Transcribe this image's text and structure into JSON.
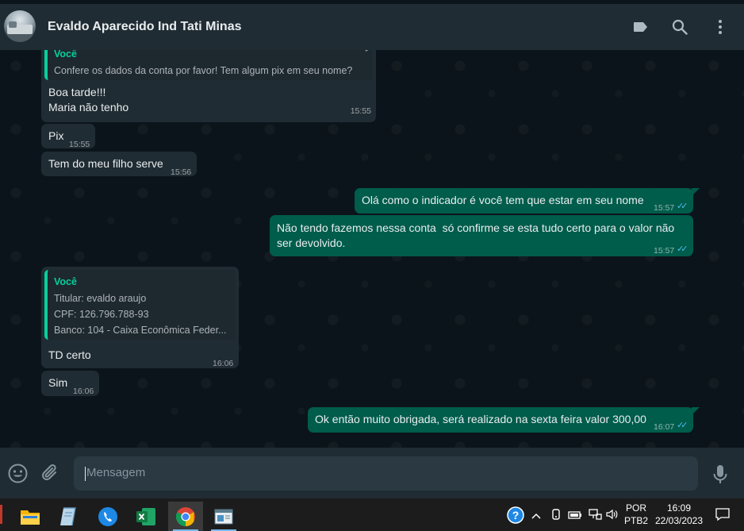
{
  "header": {
    "contact_name": "Evaldo Aparecido Ind Tati Minas",
    "icons": [
      "label-icon",
      "search-icon",
      "menu-icon"
    ]
  },
  "messages": [
    {
      "direction": "incoming",
      "quote": {
        "name": "Você",
        "lines": [
          "Confere os dados da conta por favor! Tem algum pix em seu nome?"
        ]
      },
      "lines": [
        "Boa tarde!!!",
        "Maria não tenho"
      ],
      "time": "15:55"
    },
    {
      "direction": "incoming",
      "text": "Pix",
      "time": "15:55"
    },
    {
      "direction": "incoming",
      "text": "Tem do meu filho serve",
      "time": "15:56"
    },
    {
      "direction": "outgoing",
      "text": "Olá como o indicador é você tem que estar em seu nome",
      "time": "15:57",
      "status": "read"
    },
    {
      "direction": "outgoing",
      "lines": [
        "Não tendo fazemos nessa conta  só confirme se esta tudo certo para o valor não",
        "ser devolvido."
      ],
      "time": "15:57",
      "status": "read"
    },
    {
      "direction": "incoming",
      "quote": {
        "name": "Você",
        "lines": [
          "Titular: evaldo araujo",
          "CPF: 126.796.788-93",
          "Banco: 104 - Caixa Econômica Feder..."
        ]
      },
      "text": "TD certo",
      "time": "16:06"
    },
    {
      "direction": "incoming",
      "text": "Sim",
      "time": "16:06"
    },
    {
      "direction": "outgoing",
      "text": "Ok então muito obrigada, será realizado na sexta feira valor 300,00",
      "time": "16:07",
      "status": "read"
    }
  ],
  "composer": {
    "placeholder": "Mensagem",
    "icons": [
      "emoji-icon",
      "attach-icon",
      "mic-icon"
    ]
  },
  "taskbar": {
    "apps": [
      "file-explorer-icon",
      "notes-icon",
      "phone-app-icon",
      "excel-icon",
      "chrome-icon",
      "window-app-icon"
    ],
    "active_app": "chrome-icon",
    "tray": {
      "language": "POR",
      "layout": "PTB2",
      "time": "16:09",
      "date": "22/03/2023"
    }
  },
  "colors": {
    "header_bg": "#202c33",
    "chat_bg": "#0b141a",
    "incoming_bubble": "#202c33",
    "outgoing_bubble": "#005c4b",
    "accent": "#06cf9c",
    "read_ticks": "#53bdeb"
  }
}
